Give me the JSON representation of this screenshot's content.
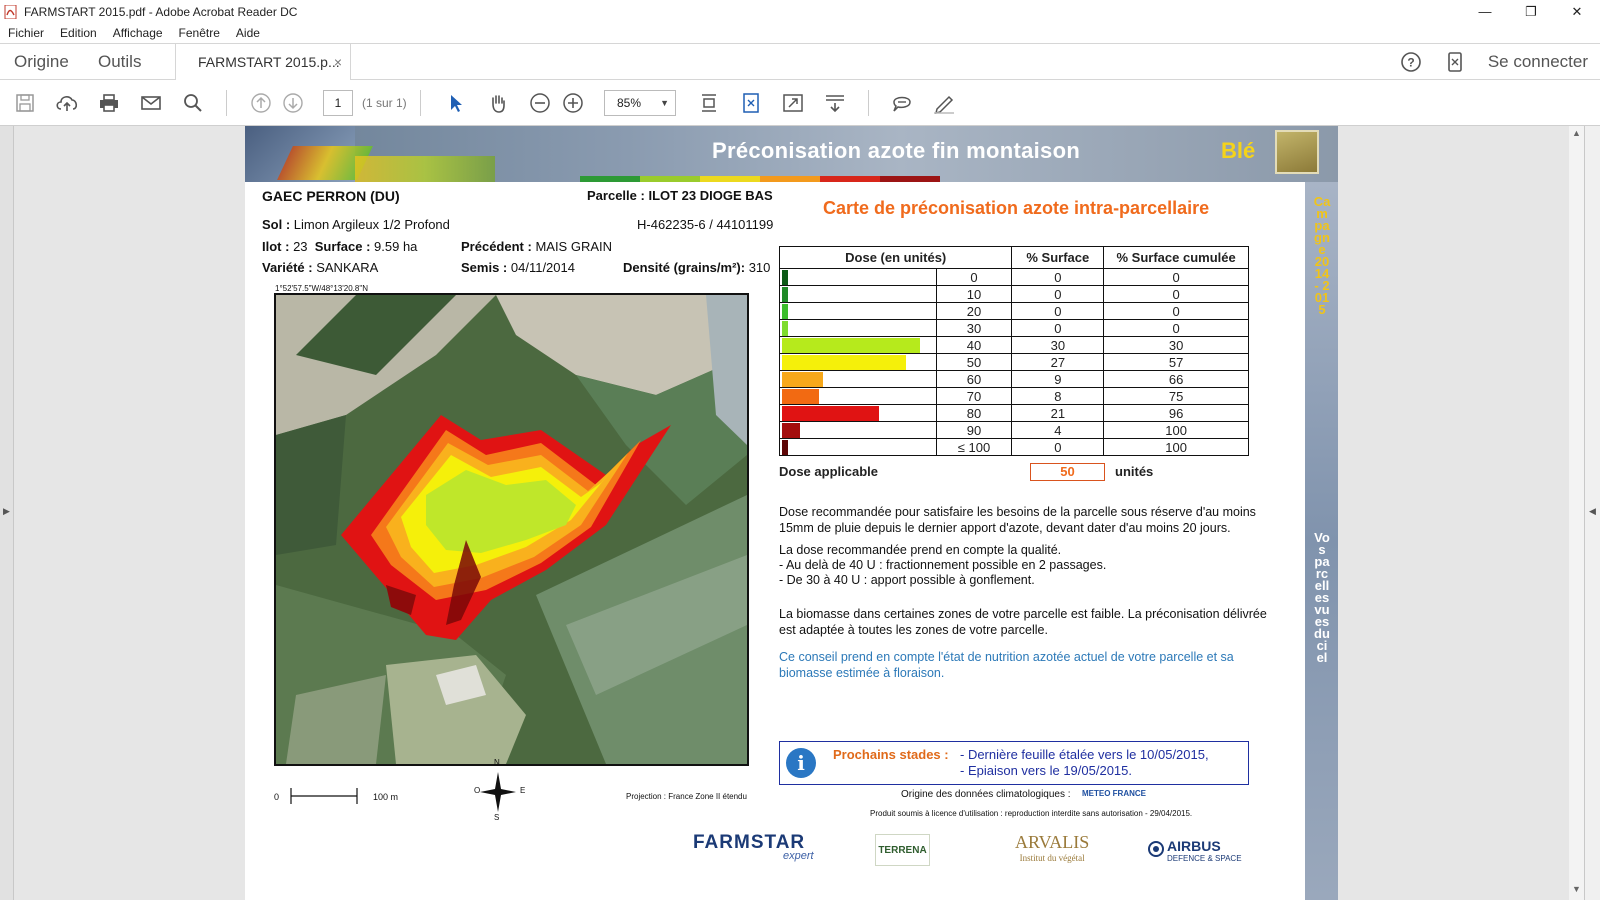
{
  "window": {
    "title": "FARMSTART 2015.pdf - Adobe Acrobat Reader DC",
    "controls": [
      "—",
      "❐",
      "✕"
    ]
  },
  "menu": [
    "Fichier",
    "Edition",
    "Affichage",
    "Fenêtre",
    "Aide"
  ],
  "tabs": {
    "home": "Origine",
    "tools": "Outils",
    "document": "FARMSTART 2015.p...",
    "close": "×",
    "connect": "Se connecter"
  },
  "toolbar": {
    "page_number": "1",
    "page_of": "(1 sur 1)",
    "zoom": "85%"
  },
  "pdf": {
    "banner_title": "Préconisation azote fin montaison",
    "banner_crop": "Blé",
    "side_campaign": "Campagne 2014 - 2015",
    "side_slogan": "Vos parcelles vues du ciel",
    "farm": "GAEC PERRON (DU)",
    "parcel_label": "Parcelle :",
    "parcel_value": "ILOT 23 DIOGE BAS",
    "sol_label": "Sol :",
    "sol_value": "Limon Argileux 1/2 Profond",
    "ref": "H-462235-6 / 44101199",
    "ilot_label": "Ilot :",
    "ilot_value": "23",
    "surface_label": "Surface :",
    "surface_value": "9.59 ha",
    "precedent_label": "Précédent :",
    "precedent_value": "MAIS GRAIN",
    "variete_label": "Variété :",
    "variete_value": "SANKARA",
    "semis_label": "Semis :",
    "semis_value": "04/11/2014",
    "densite_label": "Densité (grains/m²):",
    "densite_value": "310",
    "coord": "1°52'57.5\"W/48°13'20.8\"N",
    "scale_zero": "0",
    "scale_len": "100 m",
    "compass": {
      "n": "N",
      "s": "S",
      "e": "E",
      "w": "O"
    },
    "projection": "Projection : France Zone II étendu",
    "card_title": "Carte de préconisation azote intra-parcellaire",
    "table_headers": [
      "Dose (en unités)",
      "% Surface",
      "% Surface cumulée"
    ],
    "table_rows": [
      {
        "dose": "0",
        "surface": "0",
        "cumul": "0",
        "color": "#0c5a16",
        "pct": 0
      },
      {
        "dose": "10",
        "surface": "0",
        "cumul": "0",
        "color": "#1f8a27",
        "pct": 0
      },
      {
        "dose": "20",
        "surface": "0",
        "cumul": "0",
        "color": "#3bbd2b",
        "pct": 0
      },
      {
        "dose": "30",
        "surface": "0",
        "cumul": "0",
        "color": "#7fdc2e",
        "pct": 0
      },
      {
        "dose": "40",
        "surface": "30",
        "cumul": "30",
        "color": "#b6ea1c",
        "pct": 30
      },
      {
        "dose": "50",
        "surface": "27",
        "cumul": "57",
        "color": "#f5f00a",
        "pct": 27
      },
      {
        "dose": "60",
        "surface": "9",
        "cumul": "66",
        "color": "#f7a81a",
        "pct": 9
      },
      {
        "dose": "70",
        "surface": "8",
        "cumul": "75",
        "color": "#f26a12",
        "pct": 8
      },
      {
        "dose": "80",
        "surface": "21",
        "cumul": "96",
        "color": "#e01313",
        "pct": 21
      },
      {
        "dose": "90",
        "surface": "4",
        "cumul": "100",
        "color": "#a40d0d",
        "pct": 4
      },
      {
        "dose": "≤ 100",
        "surface": "0",
        "cumul": "100",
        "color": "#5e0606",
        "pct": 0
      }
    ],
    "dose_applicable_label": "Dose applicable",
    "dose_applicable_value": "50",
    "dose_unit": "unités",
    "para1": "Dose recommandée pour satisfaire les besoins de la parcelle sous réserve d'au moins 15mm de pluie depuis le dernier apport d'azote, devant dater d'au moins 20 jours.",
    "para2a": "La dose recommandée prend en compte la qualité.",
    "para2b": "- Au delà de 40 U : fractionnement possible en 2 passages.",
    "para2c": "- De 30 à 40 U : apport possible à gonflement.",
    "para3": "La biomasse dans certaines zones de votre parcelle est faible. La préconisation délivrée est adaptée à toutes les zones de votre parcelle.",
    "para4": "Ce conseil prend en compte l'état de nutrition azotée actuel de votre parcelle et sa biomasse estimée à floraison.",
    "stades_label": "Prochains stades :",
    "stades_1": "- Dernière feuille étalée vers le 10/05/2015,",
    "stades_2": "- Epiaison vers le 19/05/2015.",
    "clim_label": "Origine des données climatologiques :",
    "clim_source": "METEO FRANCE",
    "license": "Produit soumis à licence d'utilisation : reproduction interdite sans autorisation - 29/04/2015.",
    "logos": {
      "farmstar": "FARMSTAR",
      "farmstar_sub": "expert",
      "terrena": "TERRENA",
      "arvalis": "ARVALIS",
      "arvalis_sub": "Institut du végétal",
      "airbus": "AIRBUS",
      "airbus_sub": "DEFENCE & SPACE"
    }
  }
}
